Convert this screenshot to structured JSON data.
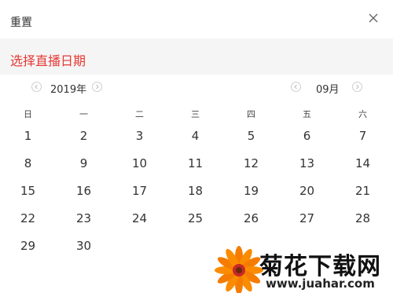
{
  "header": {
    "reset_label": "重置",
    "close_icon": "close-icon"
  },
  "section": {
    "title": "选择直播日期",
    "title_color": "#e53935"
  },
  "year_nav": {
    "label": "2019年",
    "prev_icon": "chevron-left-icon",
    "next_icon": "chevron-right-icon"
  },
  "month_nav": {
    "label": "09月",
    "prev_icon": "chevron-left-icon",
    "next_icon": "chevron-right-icon"
  },
  "weekdays": [
    "日",
    "一",
    "二",
    "三",
    "四",
    "五",
    "六"
  ],
  "weeks": [
    [
      "1",
      "2",
      "3",
      "4",
      "5",
      "6",
      "7"
    ],
    [
      "8",
      "9",
      "10",
      "11",
      "12",
      "13",
      "14"
    ],
    [
      "15",
      "16",
      "17",
      "18",
      "19",
      "20",
      "21"
    ],
    [
      "22",
      "23",
      "24",
      "25",
      "26",
      "27",
      "28"
    ],
    [
      "29",
      "30"
    ]
  ],
  "watermark": {
    "title": "菊花下载网",
    "url": "www.juahar.com"
  }
}
